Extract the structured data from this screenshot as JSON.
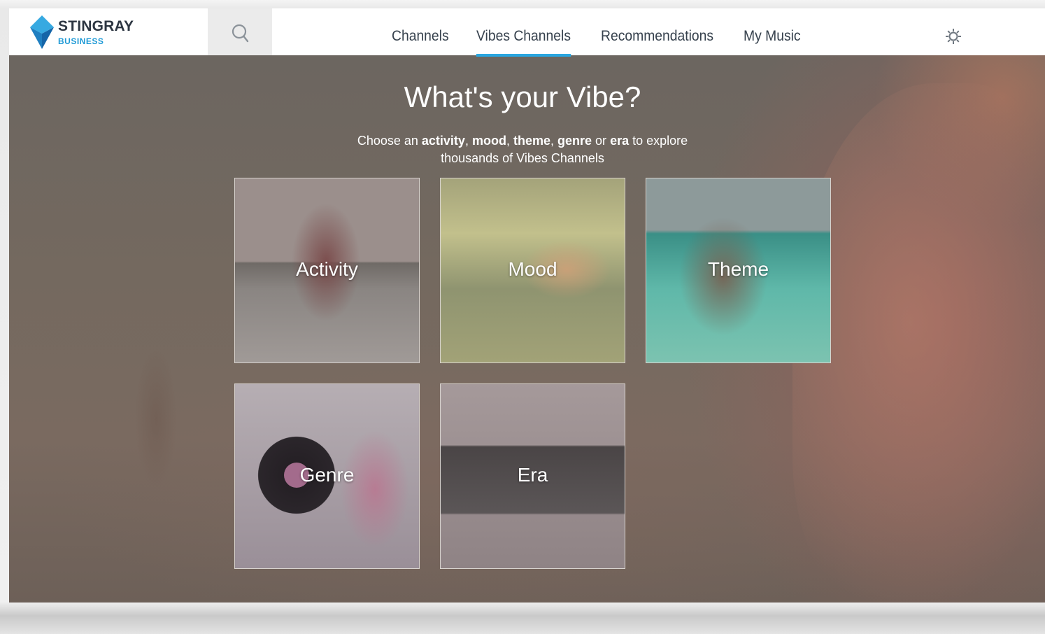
{
  "brand": {
    "name": "STINGRAY",
    "sub": "BUSINESS",
    "colors": {
      "dark": "#2d3642",
      "accent": "#1f9ad6"
    }
  },
  "header": {
    "search_icon": "search-icon",
    "settings_icon": "gear-icon",
    "nav": [
      {
        "label": "Channels",
        "active": false
      },
      {
        "label": "Vibes Channels",
        "active": true
      },
      {
        "label": "Recommendations",
        "active": false
      },
      {
        "label": "My Music",
        "active": false
      }
    ],
    "active_underline_color": "#2aa6e0"
  },
  "hero": {
    "title": "What's your Vibe?",
    "subtitle": {
      "prefix": "Choose an ",
      "activity": "activity",
      "sep1": ", ",
      "mood": "mood",
      "sep2": ", ",
      "theme": "theme",
      "sep3": ", ",
      "genre": "genre",
      "or": " or ",
      "era": "era",
      "suffix": " to explore",
      "line2": "thousands of Vibes Channels"
    }
  },
  "tiles": [
    {
      "label": "Activity"
    },
    {
      "label": "Mood"
    },
    {
      "label": "Theme"
    },
    {
      "label": "Genre"
    },
    {
      "label": "Era"
    }
  ]
}
